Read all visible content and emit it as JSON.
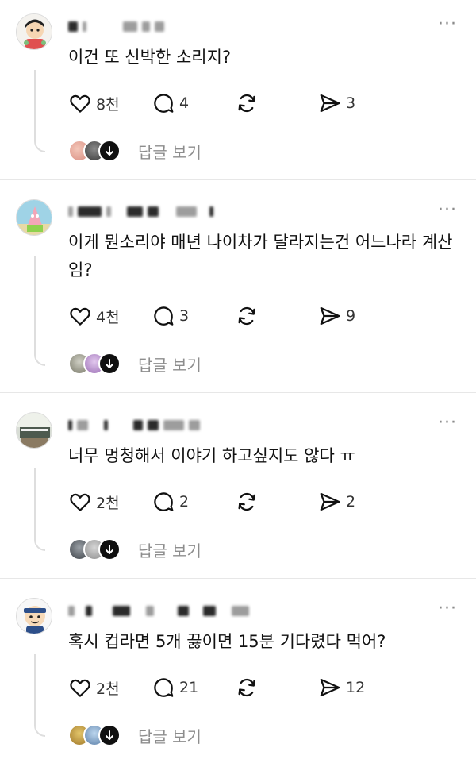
{
  "posts": [
    {
      "text": "이건 또 신박한 소리지?",
      "likes": "8천",
      "replies": "4",
      "shares": "3",
      "view_replies": "답글 보기",
      "more": "···"
    },
    {
      "text": "이게 뭔소리야 매년 나이차가 달라지는건 어느나라 계산임?",
      "likes": "4천",
      "replies": "3",
      "shares": "9",
      "view_replies": "답글 보기",
      "more": "···"
    },
    {
      "text": "너무 멍청해서 이야기 하고싶지도 않다 ㅠ",
      "likes": "2천",
      "replies": "2",
      "shares": "2",
      "view_replies": "답글 보기",
      "more": "···"
    },
    {
      "text": "혹시 컵라면 5개 끓이면 15분 기다렸다 먹어?",
      "likes": "2천",
      "replies": "21",
      "shares": "12",
      "view_replies": "답글 보기",
      "more": "···"
    }
  ],
  "icons": {
    "like": "heart-icon",
    "reply": "comment-bubble-icon",
    "repost": "repost-icon",
    "share": "send-icon",
    "more": "more-options-icon",
    "expand": "arrow-down-icon"
  }
}
